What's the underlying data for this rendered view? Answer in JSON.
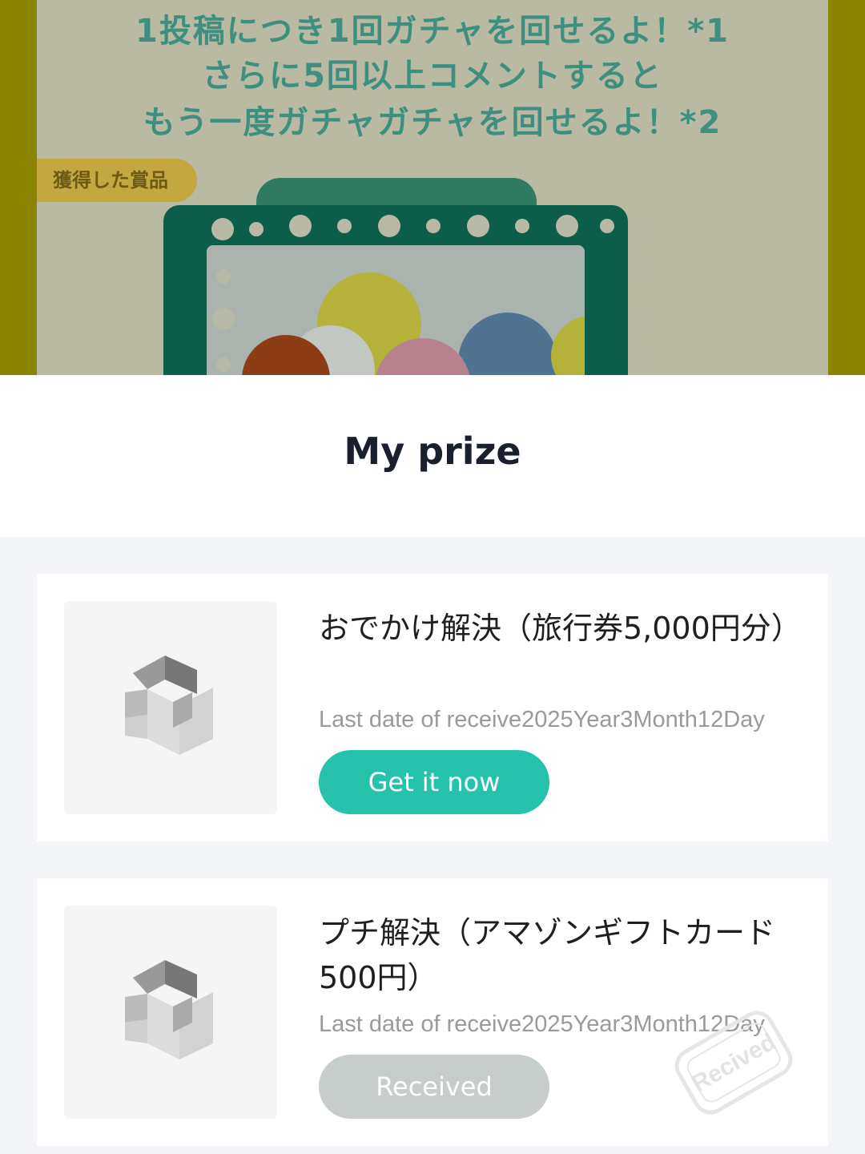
{
  "banner": {
    "line1": "1投稿につき1回ガチャを回せるよ！*1",
    "line2": "さらに5回以上コメントすると",
    "line3": "もう一度ガチャガチャを回せるよ！*2",
    "prize_tag": "獲得した賞品"
  },
  "sheet": {
    "title": "My prize"
  },
  "prizes": [
    {
      "name": "おでかけ解決（旅行券5,000円分）",
      "deadline": "Last date of receive2025Year3Month12Day",
      "button": "Get it now",
      "status": "available"
    },
    {
      "name": "プチ解決（アマゾンギフトカード500円）",
      "deadline": "Last date of receive2025Year3Month12Day",
      "button": "Received",
      "stamp": "Recived",
      "status": "received"
    }
  ],
  "colors": {
    "primary_button": "#27c2ac",
    "disabled_button": "#c6cdcb",
    "title_text": "#1a1f2e"
  }
}
